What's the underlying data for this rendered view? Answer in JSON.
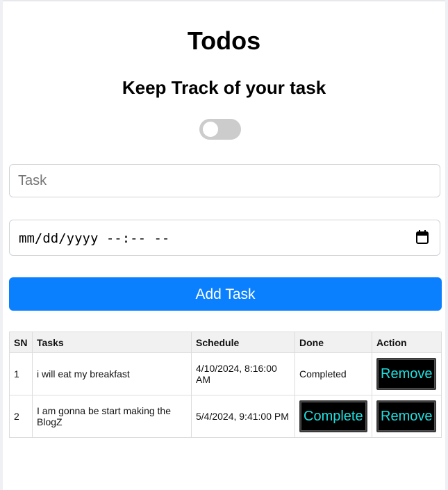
{
  "page": {
    "title": "Todos",
    "subtitle": "Keep Track of your task",
    "theme_toggle": {
      "state": "off"
    }
  },
  "form": {
    "task_placeholder": "Task",
    "task_value": "",
    "datetime_placeholder": "mm/dd/yyyy --:-- --",
    "add_button_label": "Add Task"
  },
  "table": {
    "headers": {
      "sn": "SN",
      "tasks": "Tasks",
      "schedule": "Schedule",
      "done": "Done",
      "action": "Action"
    },
    "rows": [
      {
        "sn": "1",
        "task": "i will eat my breakfast",
        "schedule": "4/10/2024, 8:16:00 AM",
        "done_status": "Completed",
        "action_label": "Remove"
      },
      {
        "sn": "2",
        "task": "I am gonna be start making the BlogZ",
        "schedule": "5/4/2024, 9:41:00 PM",
        "done_button_label": "Complete",
        "action_label": "Remove"
      }
    ]
  },
  "colors": {
    "primary_button": "#0a80ff",
    "action_button_bg": "#000000",
    "action_button_text": "#1fe0e0",
    "toggle_off": "#cccccc"
  },
  "icons": {
    "date_picker": "calendar-icon"
  }
}
